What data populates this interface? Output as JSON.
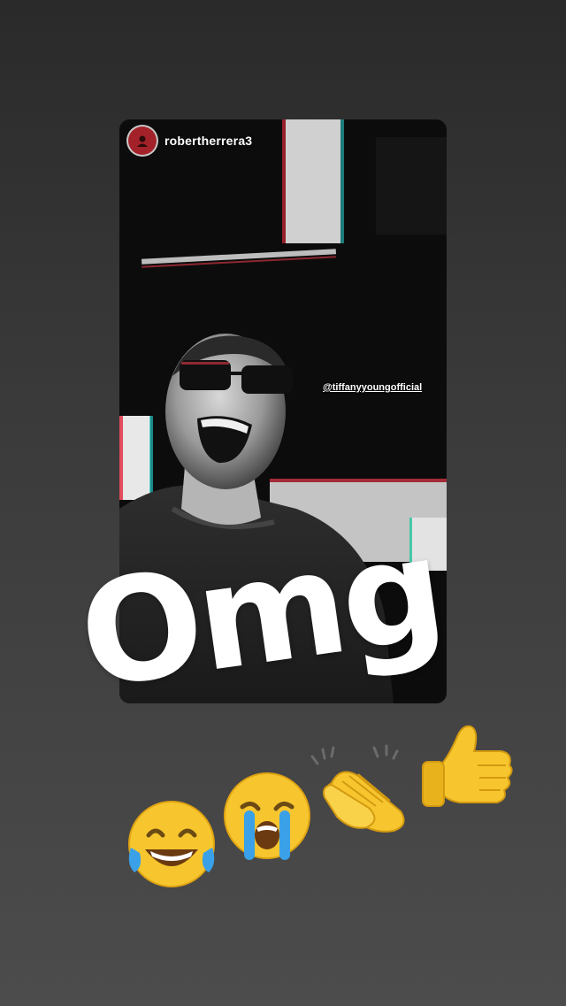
{
  "story": {
    "author": "robertherrera3",
    "mention": "@tiffanyyoungofficial"
  },
  "sticker": {
    "text": "Omg"
  },
  "emojis": [
    {
      "name": "face-with-tears-of-joy-icon"
    },
    {
      "name": "loudly-crying-face-icon"
    },
    {
      "name": "clapping-hands-icon"
    },
    {
      "name": "thumbs-up-icon"
    }
  ],
  "colors": {
    "background_top": "#2a2a2a",
    "background_bottom": "#4c4c4c",
    "avatar": "#a3222a",
    "emoji_yellow": "#f7c62f"
  }
}
